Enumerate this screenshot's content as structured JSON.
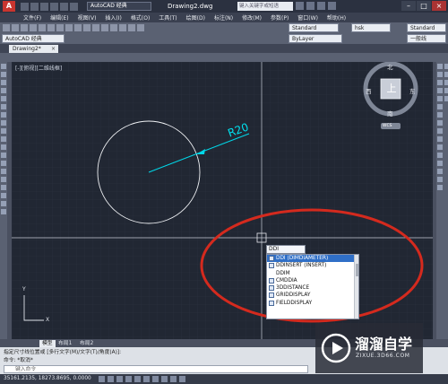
{
  "titlebar": {
    "workspace": "AutoCAD 经典",
    "document_title": "Drawing2.dwg",
    "search_placeholder": "键入关键字或短语"
  },
  "menu": [
    "文件(F)",
    "编辑(E)",
    "视图(V)",
    "插入(I)",
    "格式(O)",
    "工具(T)",
    "绘图(D)",
    "标注(N)",
    "修改(M)",
    "参数(P)",
    "窗口(W)",
    "帮助(H)"
  ],
  "toolbar": {
    "text_style": "Standard",
    "dim_style": "hsk",
    "table_style": "Standard",
    "workspace_select": "AutoCAD 经典",
    "layer_color": "ByLayer",
    "linetype_label": "一般线"
  },
  "document_tab": {
    "label": "Drawing2*",
    "close": "×"
  },
  "viewport": {
    "label": "[-][俯视][二维线框]",
    "dimension_text": "R20",
    "viewcube": {
      "top": "上",
      "north": "北",
      "south": "南",
      "east": "东",
      "west": "西",
      "wcs": "WCS"
    },
    "ucs": {
      "x": "X",
      "y": "Y"
    }
  },
  "command_popup": {
    "typed": "DDI",
    "items": [
      "DDI (DIMDIAMETER)",
      "DDINSERT (INSERT)",
      "DDIM",
      "CMDDIA",
      "3DDISTANCE",
      "GRIDDISPLAY",
      "FIELDDISPLAY"
    ],
    "selected_index": 0
  },
  "layout_tabs": [
    "模型",
    "布局1",
    "布局2"
  ],
  "command_line": {
    "history_1": "指定尺寸线位置或",
    "history_1_options": "[多行文字(M)/文字(T)/角度(A)]:",
    "history_2": "命令: *取消*",
    "input_placeholder": "键入命令"
  },
  "status": {
    "coords": "35161.2135, 18273.8695, 0.0000"
  },
  "watermark": {
    "brand": "溜溜自学",
    "url": "ZIXUE.3D66.COM"
  },
  "colors": {
    "viewport_bg": "#212733",
    "highlight": "#2f6fc7",
    "annotation_red": "#d42a1e",
    "dim_cyan": "#00d7e8"
  }
}
